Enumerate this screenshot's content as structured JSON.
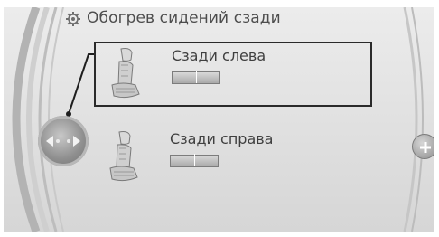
{
  "header": {
    "title": "Обогрев сидений сзади",
    "icon": "gear-icon"
  },
  "items": [
    {
      "label": "Сзади слева",
      "icon": "seat-icon",
      "selected": true,
      "heat_level": 0.5
    },
    {
      "label": "Сзади справа",
      "icon": "seat-icon",
      "selected": false,
      "heat_level": 0.5
    }
  ],
  "controller": {
    "icon": "controller-knob-icon"
  },
  "side_button": {
    "icon": "plus-icon"
  },
  "colors": {
    "background": "#e2e2e2",
    "text": "#4d4d4d",
    "selection_border": "#2a2a2a"
  }
}
